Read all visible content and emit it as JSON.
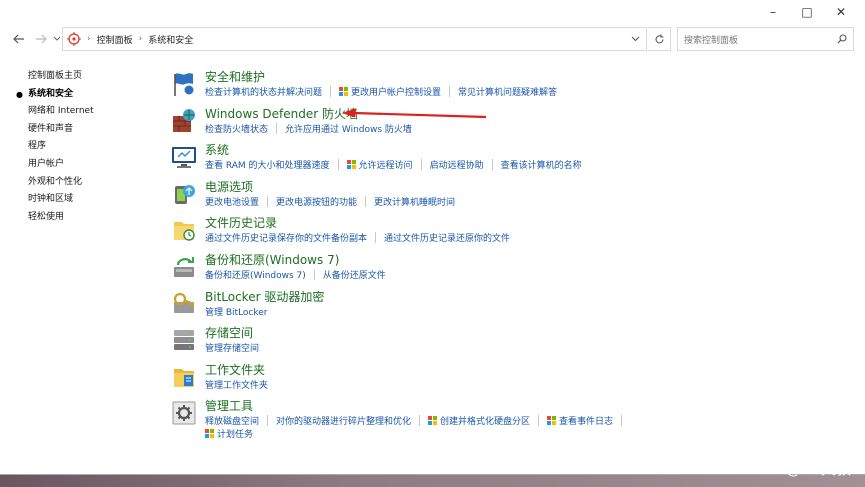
{
  "window": {
    "caption_minimize": "–",
    "caption_maximize": "□",
    "caption_close": "✕"
  },
  "nav": {
    "back_icon": "arrow-left-icon",
    "forward_icon": "arrow-right-icon",
    "recent_icon": "chevron-down-icon",
    "breadcrumb": [
      "控制面板",
      "系统和安全"
    ],
    "search_placeholder": "搜索控制面板"
  },
  "sidebar": {
    "items": [
      {
        "label": "控制面板主页",
        "current": false
      },
      {
        "label": "系统和安全",
        "current": true
      },
      {
        "label": "网络和 Internet",
        "current": false
      },
      {
        "label": "硬件和声音",
        "current": false
      },
      {
        "label": "程序",
        "current": false
      },
      {
        "label": "用户帐户",
        "current": false
      },
      {
        "label": "外观和个性化",
        "current": false
      },
      {
        "label": "时钟和区域",
        "current": false
      },
      {
        "label": "轻松使用",
        "current": false
      }
    ]
  },
  "categories": [
    {
      "title": "安全和维护",
      "icon": "flag-icon",
      "links": [
        "检查计算机的状态并解决问题",
        "更改用户帐户控制设置",
        "常见计算机问题疑难解答"
      ]
    },
    {
      "title": "Windows Defender 防火墙",
      "icon": "firewall-icon",
      "links": [
        "检查防火墙状态",
        "允许应用通过 Windows 防火墙"
      ]
    },
    {
      "title": "系统",
      "icon": "monitor-icon",
      "links": [
        "查看 RAM 的大小和处理器速度",
        "允许远程访问",
        "启动远程协助",
        "查看该计算机的名称"
      ]
    },
    {
      "title": "电源选项",
      "icon": "power-icon",
      "links": [
        "更改电池设置",
        "更改电源按钮的功能",
        "更改计算机睡眠时间"
      ]
    },
    {
      "title": "文件历史记录",
      "icon": "file-history-icon",
      "links": [
        "通过文件历史记录保存你的文件备份副本",
        "通过文件历史记录还原你的文件"
      ]
    },
    {
      "title": "备份和还原(Windows 7)",
      "icon": "backup-icon",
      "links": [
        "备份和还原(Windows 7)",
        "从备份还原文件"
      ]
    },
    {
      "title": "BitLocker 驱动器加密",
      "icon": "key-icon",
      "links": [
        "管理 BitLocker"
      ]
    },
    {
      "title": "存储空间",
      "icon": "storage-icon",
      "links": [
        "管理存储空间"
      ]
    },
    {
      "title": "工作文件夹",
      "icon": "work-folder-icon",
      "links": [
        "管理工作文件夹"
      ]
    },
    {
      "title": "管理工具",
      "icon": "admin-tools-icon",
      "links": [
        "释放磁盘空间",
        "对你的驱动器进行碎片整理和优化",
        "创建并格式化硬盘分区",
        "查看事件日志"
      ],
      "links2": [
        "计划任务"
      ]
    }
  ],
  "watermark": "CSDN @Hi 大叔",
  "colors": {
    "category_title": "#1e6e22",
    "link": "#1a56a8",
    "annotation_arrow": "#e02020"
  }
}
